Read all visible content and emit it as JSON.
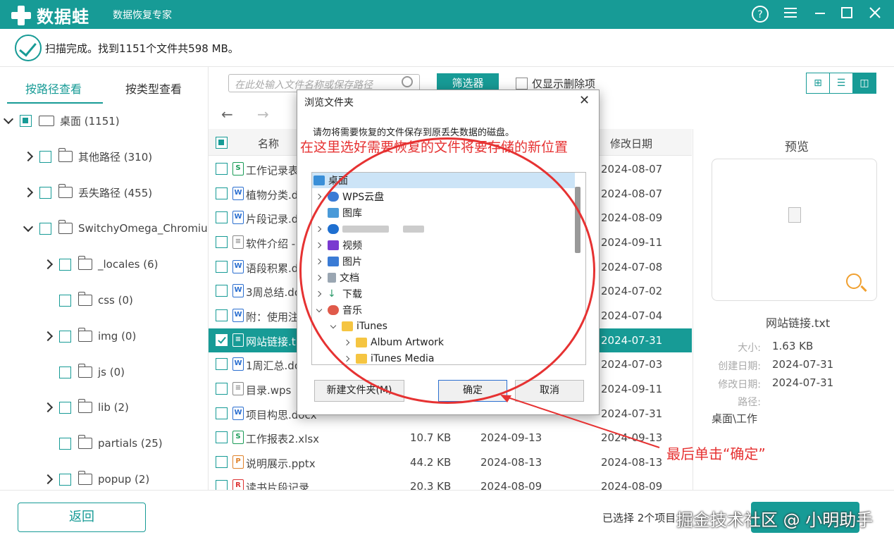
{
  "app": {
    "name": "数据蛙",
    "subtitle": "数据恢复专家"
  },
  "status": {
    "text": "扫描完成。找到1151个文件共598 MB。"
  },
  "left_tabs": {
    "by_path": "按路径查看",
    "by_type": "按类型查看"
  },
  "tree": [
    {
      "label": "桌面 (1151)"
    },
    {
      "label": "其他路径 (310)"
    },
    {
      "label": "丢失路径 (455)"
    },
    {
      "label": "SwitchyOmega_Chromium"
    },
    {
      "label": "_locales (6)"
    },
    {
      "label": "css (0)"
    },
    {
      "label": "img (0)"
    },
    {
      "label": "js (0)"
    },
    {
      "label": "lib (2)"
    },
    {
      "label": "partials (25)"
    },
    {
      "label": "popup (2)"
    }
  ],
  "toolbar": {
    "search_placeholder": "在此处输入文件名称或保存路径",
    "filter_label": "筛选器",
    "only_deleted": "仅显示删除项",
    "view_grid": "⊞",
    "view_list": "☰",
    "view_detail": "◫"
  },
  "list_headers": {
    "name": "名称",
    "modified": "修改日期"
  },
  "files": [
    {
      "name": "工作记录表",
      "type": "S",
      "size": "",
      "created": "",
      "modified": "2024-08-07"
    },
    {
      "name": "植物分类.d",
      "type": "W",
      "size": "",
      "created": "",
      "modified": "2024-08-07"
    },
    {
      "name": "片段记录.d",
      "type": "W",
      "size": "",
      "created": "",
      "modified": "2024-08-09"
    },
    {
      "name": "软件介绍 -",
      "type": "T",
      "size": "",
      "created": "",
      "modified": "2024-09-11"
    },
    {
      "name": "语段积累.d",
      "type": "W",
      "size": "",
      "created": "",
      "modified": "2024-07-08"
    },
    {
      "name": "3周总结.do",
      "type": "W",
      "size": "",
      "created": "",
      "modified": "2024-07-02"
    },
    {
      "name": "附：使用注",
      "type": "W",
      "size": "",
      "created": "",
      "modified": "2024-07-04"
    },
    {
      "name": "网站链接.t",
      "type": "T",
      "size": "",
      "created": "",
      "modified": "2024-07-31"
    },
    {
      "name": "1周汇总.do",
      "type": "W",
      "size": "",
      "created": "",
      "modified": "2024-07-03"
    },
    {
      "name": "目录.wps",
      "type": "T",
      "size": "",
      "created": "",
      "modified": "2024-09-11"
    },
    {
      "name": "项目构思.docx",
      "type": "W",
      "size": "",
      "created": "",
      "modified": "2024-07-31"
    },
    {
      "name": "工作报表2.xlsx",
      "type": "S",
      "size": "10.7 KB",
      "created": "2024-09-13",
      "modified": "2024-09-13"
    },
    {
      "name": "说明展示.pptx",
      "type": "P",
      "size": "44.2 KB",
      "created": "2024-08-13",
      "modified": "2024-08-13"
    },
    {
      "name": "读书片段记录....",
      "type": "R",
      "size": "20.3 KB",
      "created": "2024-08-09",
      "modified": "2024-08-09"
    }
  ],
  "preview": {
    "title": "预览",
    "filename": "网站链接.txt",
    "size_label": "大小:",
    "size": "1.63 KB",
    "created_label": "创建日期:",
    "created": "2024-07-31",
    "modified_label": "修改日期:",
    "modified": "2024-07-31",
    "path_label": "路径:",
    "path": "桌面\\工作"
  },
  "bottom": {
    "back": "返回",
    "selected_info": "已选择 2个项目",
    "watermark": "掘金技术社区 @ 小明助手"
  },
  "dialog": {
    "title": "浏览文件夹",
    "message": "请勿将需要恢复的文件保存到原丢失数据的磁盘。",
    "tree": [
      {
        "label": "桌面"
      },
      {
        "label": "WPS云盘"
      },
      {
        "label": "图库"
      },
      {
        "label": ""
      },
      {
        "label": "视频"
      },
      {
        "label": "图片"
      },
      {
        "label": "文档"
      },
      {
        "label": "下载"
      },
      {
        "label": "音乐"
      },
      {
        "label": "iTunes"
      },
      {
        "label": "Album Artwork"
      },
      {
        "label": "iTunes Media"
      }
    ],
    "new_folder": "新建文件夹(M)",
    "ok": "确定",
    "cancel": "取消"
  },
  "annotations": {
    "dialog_hint": "在这里选好需要恢复的文件将要存储的新位置",
    "final_click": "最后单击“确定”"
  },
  "colors": {
    "accent": "#179b96",
    "annotation": "#e63232"
  }
}
